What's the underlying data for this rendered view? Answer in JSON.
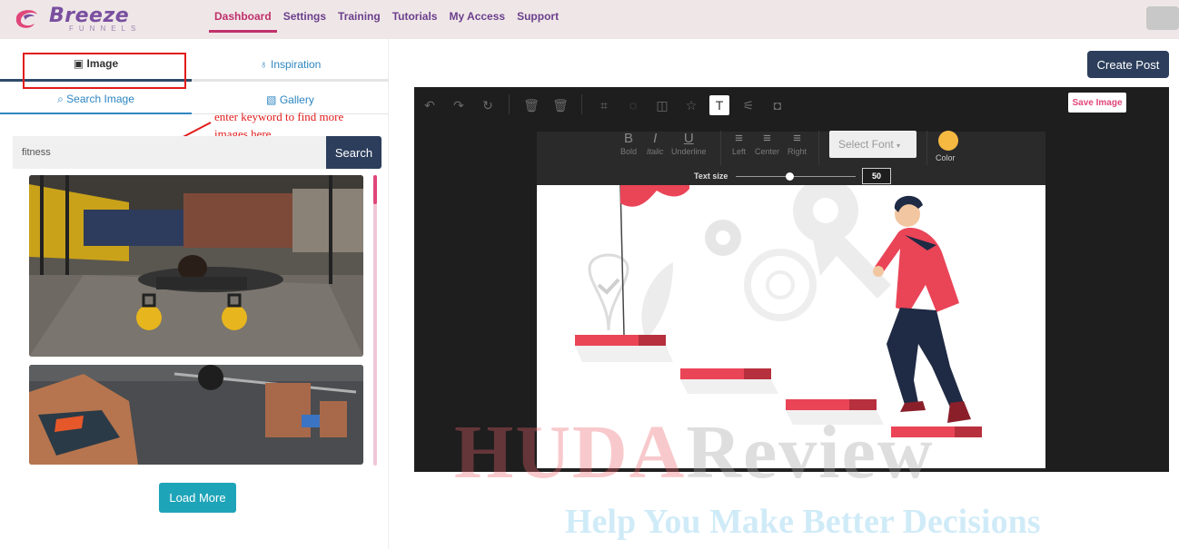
{
  "header": {
    "logo_text": "Breeze",
    "logo_sub": "FUNNELS",
    "nav": [
      {
        "label": "Dashboard",
        "active": true
      },
      {
        "label": "Settings"
      },
      {
        "label": "Training"
      },
      {
        "label": "Tutorials"
      },
      {
        "label": "My Access"
      },
      {
        "label": "Support"
      }
    ]
  },
  "left_panel": {
    "tabs": [
      {
        "label": "Image",
        "icon": "image-icon",
        "active": true
      },
      {
        "label": "Inspiration",
        "icon": "lightbulb-icon"
      }
    ],
    "subtabs": [
      {
        "label": "Search Image",
        "icon": "search-icon",
        "active": true
      },
      {
        "label": "Gallery",
        "icon": "gallery-icon"
      }
    ],
    "annotation": "enter keyword to find more images here",
    "search": {
      "value": "fitness",
      "button": "Search"
    },
    "results": [
      "fitness-pushup-kettlebells-photo",
      "fitness-deadlift-barbell-photo"
    ],
    "load_more": "Load More"
  },
  "right_panel": {
    "create_post": "Create Post",
    "editor": {
      "toolbar_icons": [
        "undo-icon",
        "redo-icon",
        "reset-icon",
        "delete-icon",
        "delete-all-icon",
        "crop-icon",
        "rotate-icon",
        "flip-icon",
        "shape-icon",
        "text-icon",
        "filter-icon",
        "mask-icon"
      ],
      "selected_tool": "text-icon",
      "save_image": "Save Image",
      "format": [
        {
          "glyph": "B",
          "label": "Bold"
        },
        {
          "glyph": "I",
          "label": "Italic"
        },
        {
          "glyph": "U",
          "label": "Underline"
        },
        {
          "glyph": "≡",
          "label": "Left"
        },
        {
          "glyph": "≡",
          "label": "Center"
        },
        {
          "glyph": "≡",
          "label": "Right"
        }
      ],
      "select_font": "Select Font",
      "color_label": "Color",
      "color_value": "#f5b942",
      "text_size_label": "Text size",
      "text_size": "50"
    }
  },
  "watermark": {
    "line1_a": "HUDA",
    "line1_b": "Review",
    "line2": "Help You Make Better Decisions"
  }
}
